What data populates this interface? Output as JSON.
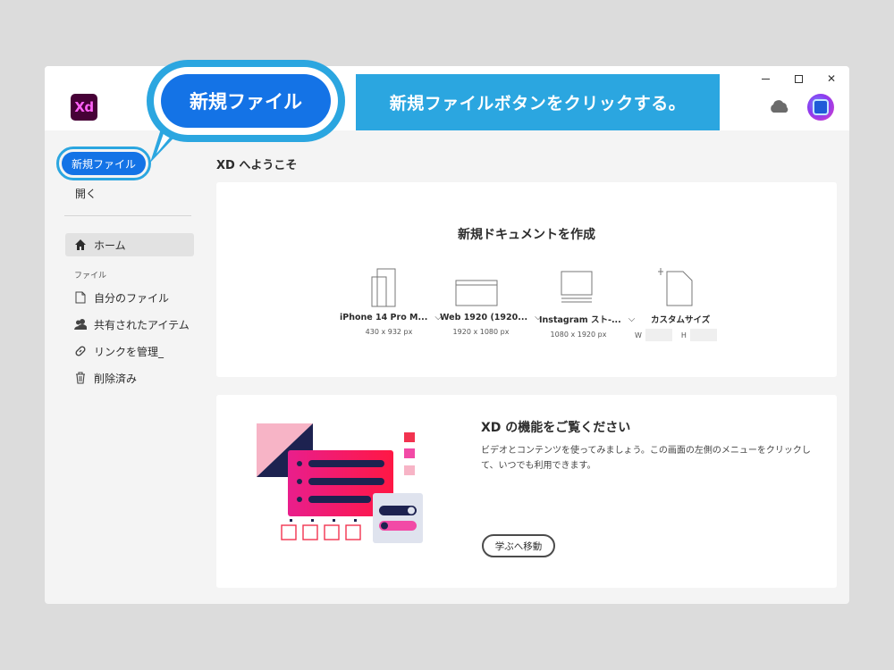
{
  "app": {
    "logo_text": "Xd",
    "brand_color": "#470137",
    "logo_accent": "#ff61f6"
  },
  "titlebar": {
    "minimize": "—",
    "maximize": "□",
    "close": "✕",
    "cloud_icon": "cloud-icon",
    "avatar_icon": "avatar"
  },
  "sidebar": {
    "new_file_label": "新規ファイル",
    "open_label": "開く",
    "home_label": "ホーム",
    "section_label": "ファイル",
    "items": [
      {
        "label": "自分のファイル",
        "icon": "document-icon"
      },
      {
        "label": "共有されたアイテム",
        "icon": "people-icon"
      },
      {
        "label": "リンクを管理_",
        "icon": "link-icon"
      },
      {
        "label": "削除済み",
        "icon": "trash-icon"
      }
    ]
  },
  "main": {
    "welcome": "XD へようこそ",
    "new_doc": {
      "title": "新規ドキュメントを作成",
      "presets": [
        {
          "name": "iPhone 14 Pro M...",
          "size": "430 x 932 px"
        },
        {
          "name": "Web 1920 (1920...",
          "size": "1920 x 1080 px"
        },
        {
          "name": "Instagram スト-...",
          "size": "1080 x 1920 px"
        },
        {
          "name": "カスタムサイズ",
          "w_label": "W",
          "h_label": "H"
        }
      ]
    },
    "learn": {
      "title": "XD の機能をご覧ください",
      "description": "ビデオとコンテンツを使ってみましょう。この画面の左側のメニューをクリックして、いつでも利用できます。",
      "button": "学ぶへ移動"
    }
  },
  "annotation": {
    "callout_label": "新規ファイル",
    "instruction": "新規ファイルボタンをクリックする。",
    "accent": "#2ba6e0",
    "button_blue": "#1473e6"
  }
}
